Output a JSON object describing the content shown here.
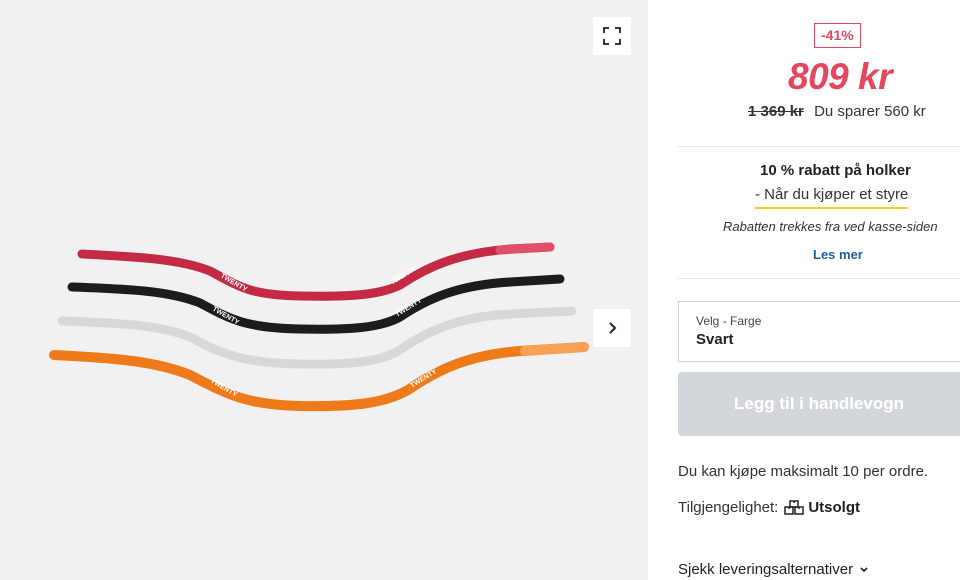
{
  "gallery": {
    "fullscreen_icon": "fullscreen-icon",
    "next_icon": "chevron-right-icon",
    "product_image": {
      "description_icon": "handlebar-image",
      "brand_text": "TWENTY",
      "colors": [
        "#c42a44",
        "#1c1c1c",
        "#d8d8d8",
        "#ef7a1a"
      ]
    }
  },
  "pricing": {
    "discount_badge": "-41%",
    "price": "809 kr",
    "old_price": "1 369 kr",
    "savings": "Du sparer 560 kr"
  },
  "promo": {
    "title": "10 % rabatt på holker",
    "subtitle": "- Når du kjøper et styre",
    "note": "Rabatten trekkes fra ved kasse-siden",
    "read_more": "Les mer"
  },
  "color_select": {
    "label": "Velg - Farge",
    "value": "Svart"
  },
  "cart_button": {
    "label": "Legg til i handlevogn"
  },
  "max_order": "Du kan kjøpe maksimalt 10 per ordre.",
  "availability": {
    "label": "Tilgjengelighet:",
    "icon": "boxes-icon",
    "status": "Utsolgt"
  },
  "delivery": {
    "label": "Sjekk leveringsalternativer",
    "icon": "chevron-down-icon"
  }
}
